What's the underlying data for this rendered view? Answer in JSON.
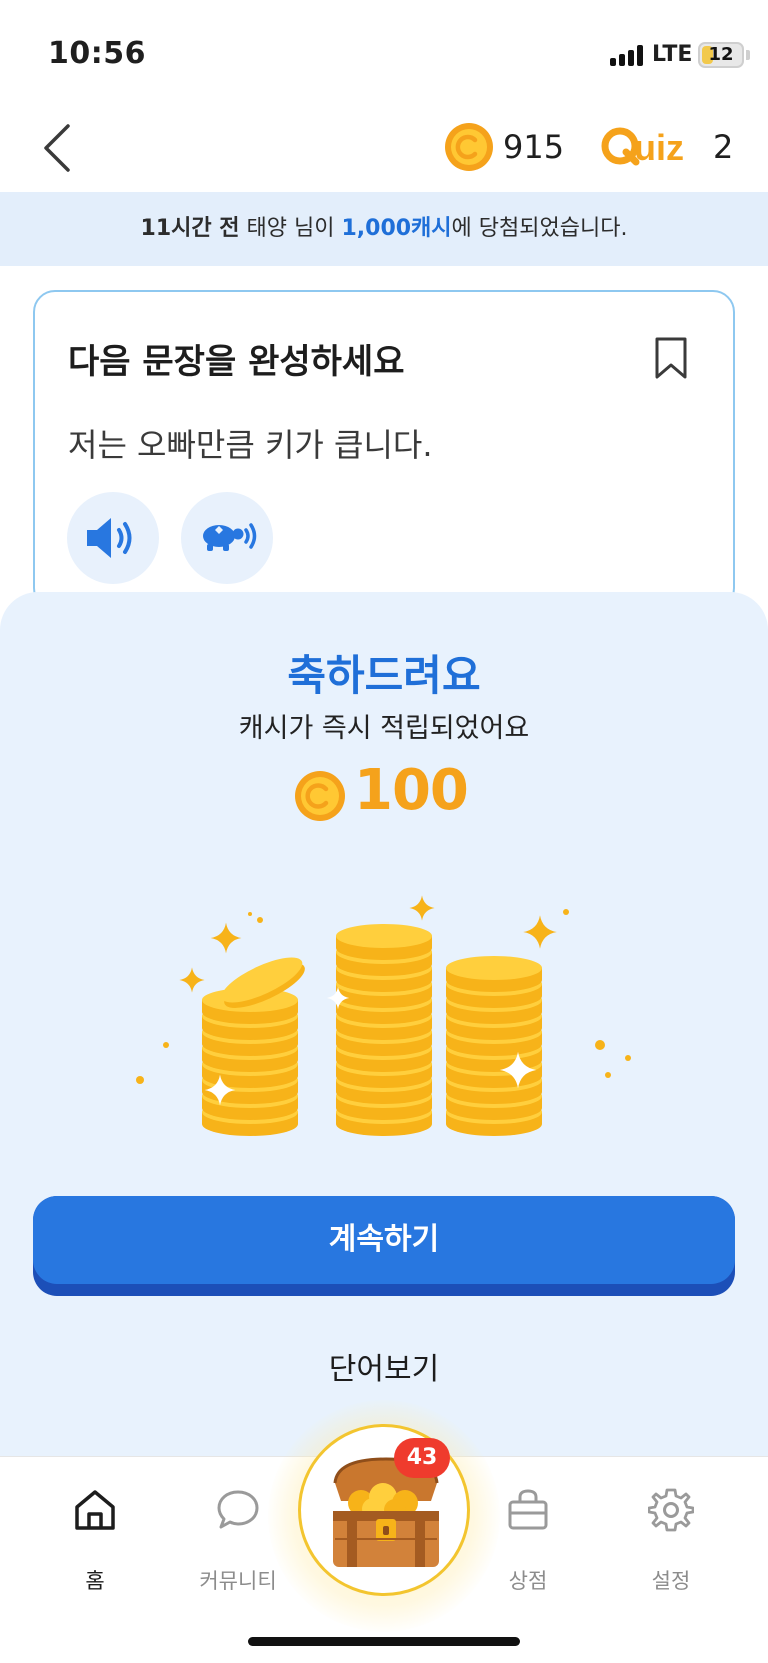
{
  "status_bar": {
    "time": "10:56",
    "network": "LTE",
    "battery": "12"
  },
  "header": {
    "back_icon": "chevron-left-icon",
    "coin_icon": "cash-coin-icon",
    "coin_count": "915",
    "quiz_logo_text": "Quiz",
    "quiz_count": "2"
  },
  "notice": {
    "time_ago": "11시간 전",
    "user_text": " 태양 님이 ",
    "amount": "1,000캐시",
    "suffix": "에 당첨되었습니다."
  },
  "question": {
    "title": "다음 문장을 완성하세요",
    "sentence": "저는 오빠만큼 키가 큽니다.",
    "bookmark_icon": "bookmark-icon",
    "audio_normal_icon": "speaker-icon",
    "audio_slow_icon": "turtle-speaker-icon"
  },
  "result": {
    "title": "축하드려요",
    "subtitle": "캐시가 즉시 적립되었어요",
    "reward_amount": "100",
    "illustration": "coin-stacks-illustration",
    "continue_label": "계속하기",
    "words_label": "단어보기"
  },
  "bottom_nav": {
    "items": [
      {
        "label": "홈",
        "icon": "home-icon",
        "active": true
      },
      {
        "label": "커뮤니티",
        "icon": "chat-bubble-icon",
        "active": false
      },
      {
        "label": "상점",
        "icon": "shopping-bag-icon",
        "active": false
      },
      {
        "label": "설정",
        "icon": "gear-icon",
        "active": false
      }
    ],
    "chest_icon": "treasure-chest-icon",
    "chest_badge": "43"
  },
  "colors": {
    "primary_blue": "#2877e0",
    "coin_orange": "#f5a21b",
    "badge_red": "#ef3b2d",
    "sheet_bg": "#e8f2fd"
  }
}
